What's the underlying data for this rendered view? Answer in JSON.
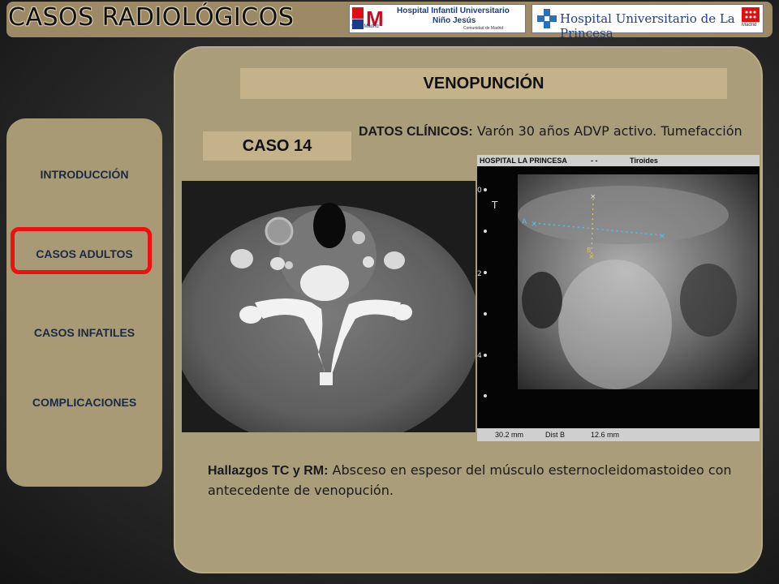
{
  "header": {
    "title": "CASOS RADIOLÓGICOS",
    "logo1": {
      "text_line1": "Hospital Infantil Universitario",
      "text_line2": "Niño Jesús",
      "mark": "M",
      "small_left": "SaludMadrid",
      "small_right": "Comunidad de Madrid"
    },
    "logo2": {
      "text": "Hospital Universitario de La Princesa",
      "small_right": "Madrid"
    }
  },
  "sidebar": {
    "items": [
      {
        "label": "INTRODUCCIÓN"
      },
      {
        "label": "CASOS ADULTOS"
      },
      {
        "label": "CASOS INFATILES"
      },
      {
        "label": "COMPLICACIONES"
      }
    ],
    "active_index": 1
  },
  "main": {
    "section_title": "VENOPUNCIÓN",
    "case_label": "CASO 14",
    "clinical": {
      "label": "DATOS CLÍNICOS:",
      "text": " Varón 30 años ADVP activo. Tumefacción"
    },
    "findings": {
      "label": "Hallazgos  TC y RM:",
      "text": " Absceso en espesor del músculo esternocleidomastoideo con antecedente de venopución."
    },
    "ultrasound": {
      "header_left": "HOSPITAL LA PRINCESA",
      "header_mid": "- -",
      "header_right": "Tiroides",
      "footer_a": "30.2  mm",
      "footer_b_label": "Dist  B",
      "footer_b": "12.6  mm",
      "marker_a": "A",
      "marker_b": "B",
      "depth_0": "0",
      "depth_2": "2",
      "depth_4": "4"
    }
  },
  "colors": {
    "header_bar": "#9c8a66",
    "sidebar_bg": "#a89a74",
    "panel_bg": "#a99d7a",
    "label_bg": "#c4b38a",
    "active_frame": "#ee1111",
    "nav_text": "#1a2a44"
  }
}
